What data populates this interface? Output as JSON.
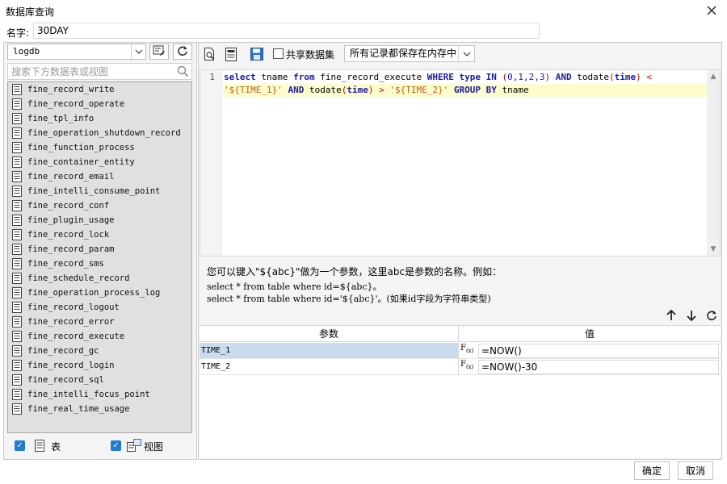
{
  "window": {
    "title": "数据库查询",
    "close_icon": "close-icon"
  },
  "name_field": {
    "label": "名字:",
    "value": "30DAY"
  },
  "left_panel": {
    "db_selected": "logdb",
    "search_placeholder": "搜索下方数据表或视图",
    "tables": [
      "fine_record_write",
      "fine_record_operate",
      "fine_tpl_info",
      "fine_operation_shutdown_record",
      "fine_function_process",
      "fine_container_entity",
      "fine_record_email",
      "fine_intelli_consume_point",
      "fine_record_conf",
      "fine_plugin_usage",
      "fine_record_lock",
      "fine_record_param",
      "fine_record_sms",
      "fine_schedule_record",
      "fine_operation_process_log",
      "fine_record_logout",
      "fine_record_error",
      "fine_record_execute",
      "fine_record_gc",
      "fine_record_login",
      "fine_record_sql",
      "fine_intelli_focus_point",
      "fine_real_time_usage"
    ],
    "show_tables_label": "表",
    "show_views_label": "视图"
  },
  "toolbar": {
    "share_label": "共享数据集",
    "memory_option": "所有记录都保存在内存中"
  },
  "editor": {
    "line_number": "1"
  },
  "hint": {
    "line1": "您可以键入\"${abc}\"做为一个参数，这里abc是参数的名称。例如：",
    "line2": "select * from table where id=${abc}。",
    "line3": "select * from table where id='${abc}'。(如果id字段为字符串类型)"
  },
  "params": {
    "header_name": "参数",
    "header_value": "值",
    "rows": [
      {
        "name": "TIME_1",
        "value": "=NOW()"
      },
      {
        "name": "TIME_2",
        "value": "=NOW()-30"
      }
    ]
  },
  "buttons": {
    "ok": "确定",
    "cancel": "取消"
  },
  "colors": {
    "checkbox": "#1e7cd6",
    "keyword": "#1a1aa8",
    "string": "#c06010",
    "selected_row": "#c9dcee",
    "highlight_line": "#fcfccd"
  }
}
